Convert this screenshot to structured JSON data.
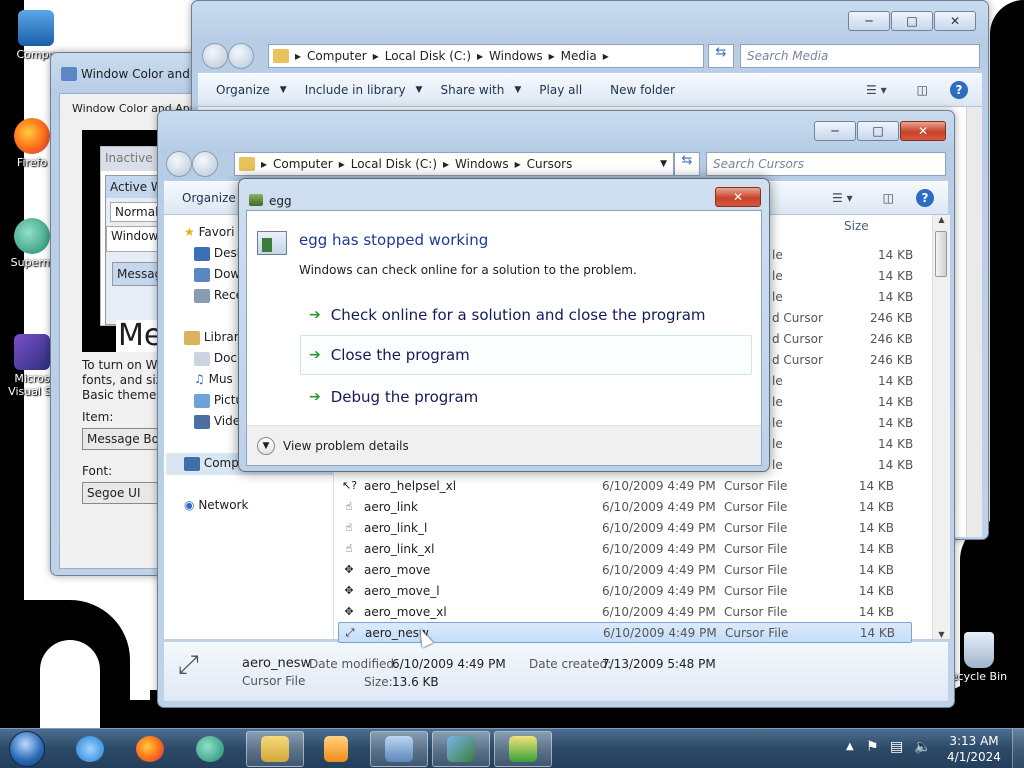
{
  "desktop": {
    "icons": [
      {
        "label": "Compu"
      },
      {
        "label": "Firefo"
      },
      {
        "label": "Superm"
      },
      {
        "label": "Micros"
      },
      {
        "label": "Visual St"
      },
      {
        "label": "ecycle Bin"
      }
    ]
  },
  "color_window": {
    "title": "Window Color and A",
    "group_label": "Window Color and Appea",
    "preview": {
      "inactive": "Inactive W",
      "active": "Active W",
      "normal": "Normal",
      "window_text": "Window",
      "message": "Messag",
      "big_text": "Me"
    },
    "description_lines": [
      "To turn on Wir",
      "fonts, and size",
      "Basic theme or"
    ],
    "item_label": "Item:",
    "item_value": "Message Box",
    "font_label": "Font:",
    "font_value": "Segoe UI"
  },
  "media_window": {
    "breadcrumb": [
      "Computer",
      "Local Disk (C:)",
      "Windows",
      "Media"
    ],
    "search_placeholder": "Search Media",
    "commands": [
      "Organize",
      "Include in library",
      "Share with",
      "Play all",
      "New folder"
    ]
  },
  "cursors_window": {
    "breadcrumb": [
      "Computer",
      "Local Disk (C:)",
      "Windows",
      "Cursors"
    ],
    "search_placeholder": "Search Cursors",
    "organize": "Organize",
    "column_size": "Size",
    "nav_items": [
      {
        "label": "Favori"
      },
      {
        "label": "Desk"
      },
      {
        "label": "Dow"
      },
      {
        "label": "Rece"
      },
      {
        "label": "Librari"
      },
      {
        "label": "Docu"
      },
      {
        "label": "Mus"
      },
      {
        "label": "Pictu"
      },
      {
        "label": "Vide"
      },
      {
        "label": "Comp"
      },
      {
        "label": "Network"
      }
    ],
    "partial_rows": [
      {
        "type": "le",
        "size": "14 KB"
      },
      {
        "type": "le",
        "size": "14 KB"
      },
      {
        "type": "le",
        "size": "14 KB"
      },
      {
        "type": "d Cursor",
        "size": "246 KB"
      },
      {
        "type": "d Cursor",
        "size": "246 KB"
      },
      {
        "type": "d Cursor",
        "size": "246 KB"
      },
      {
        "type": "le",
        "size": "14 KB"
      },
      {
        "type": "le",
        "size": "14 KB"
      },
      {
        "type": "le",
        "size": "14 KB"
      },
      {
        "type": "le",
        "size": "14 KB"
      },
      {
        "type": "le",
        "size": "14 KB"
      }
    ],
    "files": [
      {
        "name": "aero_helpsel_xl",
        "date": "6/10/2009 4:49 PM",
        "type": "Cursor File",
        "size": "14 KB"
      },
      {
        "name": "aero_link",
        "date": "6/10/2009 4:49 PM",
        "type": "Cursor File",
        "size": "14 KB"
      },
      {
        "name": "aero_link_l",
        "date": "6/10/2009 4:49 PM",
        "type": "Cursor File",
        "size": "14 KB"
      },
      {
        "name": "aero_link_xl",
        "date": "6/10/2009 4:49 PM",
        "type": "Cursor File",
        "size": "14 KB"
      },
      {
        "name": "aero_move",
        "date": "6/10/2009 4:49 PM",
        "type": "Cursor File",
        "size": "14 KB"
      },
      {
        "name": "aero_move_l",
        "date": "6/10/2009 4:49 PM",
        "type": "Cursor File",
        "size": "14 KB"
      },
      {
        "name": "aero_move_xl",
        "date": "6/10/2009 4:49 PM",
        "type": "Cursor File",
        "size": "14 KB"
      },
      {
        "name": "aero_nesw",
        "date": "6/10/2009 4:49 PM",
        "type": "Cursor File",
        "size": "14 KB"
      }
    ],
    "details": {
      "name": "aero_nesw",
      "type": "Cursor File",
      "modified_label": "Date modified:",
      "modified": "6/10/2009 4:49 PM",
      "created_label": "Date created:",
      "created": "7/13/2009 5:48 PM",
      "size_label": "Size:",
      "size": "13.6 KB"
    }
  },
  "dialog": {
    "title": "egg",
    "heading": "egg has stopped working",
    "message": "Windows can check online for a solution to the problem.",
    "options": [
      "Check online for a solution and close the program",
      "Close the program",
      "Debug the program"
    ],
    "details_toggle": "View problem details"
  },
  "taskbar": {
    "time": "3:13 AM",
    "date": "4/1/2024"
  },
  "colors": {
    "accent_link": "#1f3a93",
    "close_button": "#c7432a",
    "selection": "#c4ddf8"
  }
}
